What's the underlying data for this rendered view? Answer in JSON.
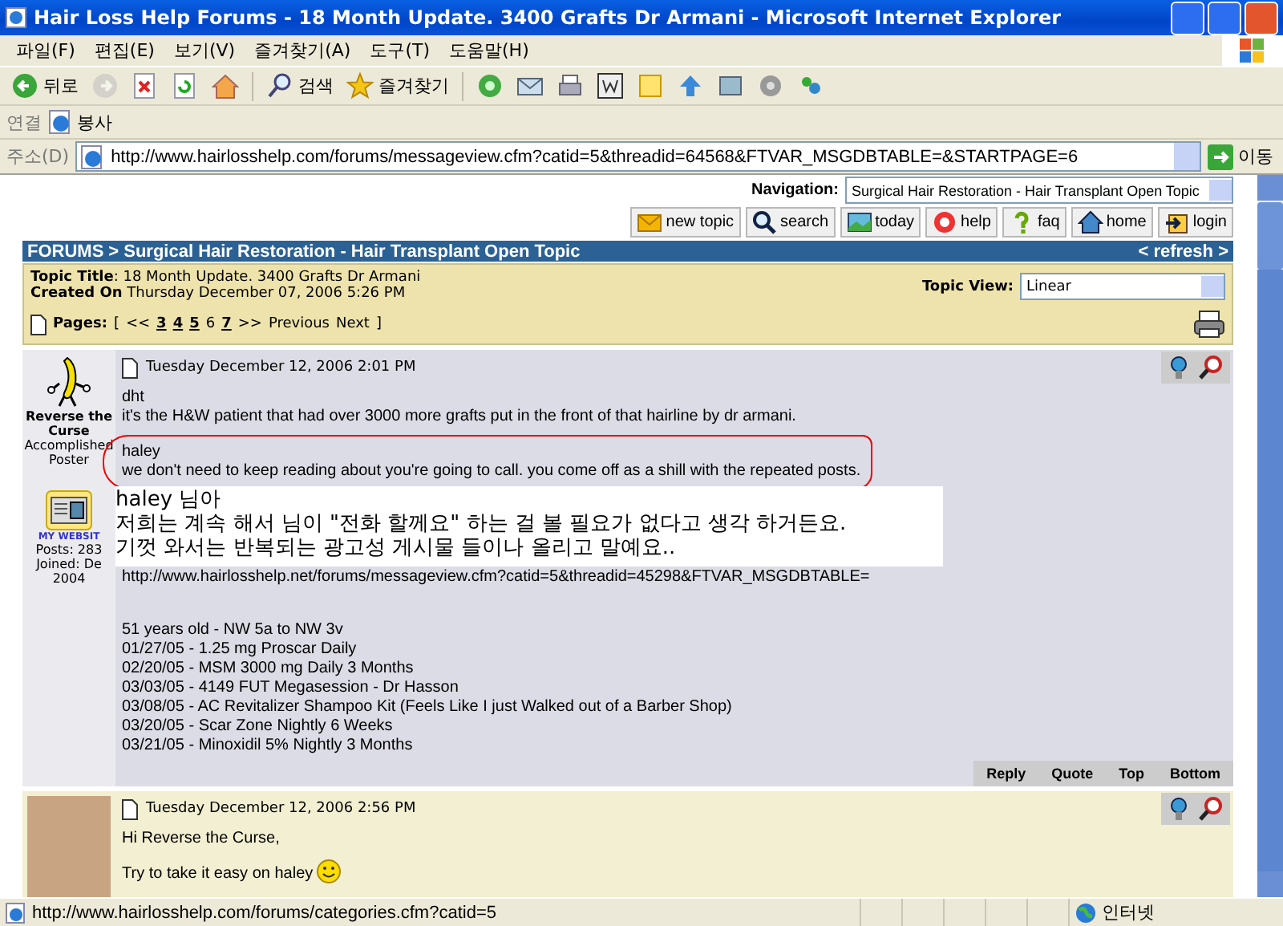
{
  "window": {
    "title": "Hair Loss Help Forums - 18 Month Update. 3400 Grafts Dr Armani - Microsoft Internet Explorer"
  },
  "menu": [
    "파일(F)",
    "편집(E)",
    "보기(V)",
    "즐겨찾기(A)",
    "도구(T)",
    "도움말(H)"
  ],
  "toolbar": [
    {
      "kind": "back",
      "label": "뒤로",
      "disabled": false
    },
    {
      "kind": "forward",
      "disabled": true
    },
    {
      "kind": "stop",
      "disabled": false
    },
    {
      "kind": "refresh",
      "disabled": false
    },
    {
      "kind": "home",
      "disabled": false
    },
    {
      "kind": "search",
      "label": "검색",
      "disabled": false
    },
    {
      "kind": "favorites",
      "label": "즐겨찾기",
      "disabled": false
    },
    {
      "kind": "media",
      "disabled": false
    },
    {
      "kind": "mail",
      "disabled": false
    },
    {
      "kind": "print",
      "disabled": false
    },
    {
      "kind": "edit",
      "disabled": false
    },
    {
      "kind": "note",
      "disabled": false
    },
    {
      "kind": "bluetool",
      "disabled": false
    },
    {
      "kind": "disk",
      "disabled": false
    },
    {
      "kind": "gear",
      "disabled": false
    },
    {
      "kind": "messenger",
      "disabled": false
    }
  ],
  "links_bar": {
    "label": "연결",
    "items": [
      "봉사"
    ]
  },
  "address": {
    "label": "주소(D)",
    "url": "http://www.hairlosshelp.com/forums/messageview.cfm?catid=5&threadid=64568&FTVAR_MSGDBTABLE=&STARTPAGE=6",
    "go": "이동"
  },
  "page": {
    "navigation": {
      "label": "Navigation:",
      "value": "Surgical Hair Restoration - Hair Transplant Open Topic"
    },
    "nav_buttons": [
      {
        "kind": "new",
        "label": "new topic"
      },
      {
        "kind": "search",
        "label": "search"
      },
      {
        "kind": "today",
        "label": "today"
      },
      {
        "kind": "help",
        "label": "help"
      },
      {
        "kind": "faq",
        "label": "faq"
      },
      {
        "kind": "home",
        "label": "home"
      },
      {
        "kind": "login",
        "label": "login"
      }
    ],
    "breadcrumb": {
      "root": "FORUMS",
      "separator": ">",
      "current": "Surgical Hair Restoration - Hair Transplant Open Topic",
      "refresh": "< refresh >"
    },
    "topic": {
      "title_label": "Topic Title",
      "title": ": 18 Month Update. 3400 Grafts Dr Armani",
      "created_label": "Created On",
      "created": "Thursday December 07, 2006 5:26 PM",
      "view_label": "Topic View:",
      "view": "Linear",
      "pages_label": "Pages:",
      "open": "[",
      "first": "<<",
      "last": ">>",
      "prev": "Previous",
      "next": "Next",
      "close": "]",
      "pages": [
        {
          "label": "3",
          "selected": false
        },
        {
          "label": "4",
          "selected": false
        },
        {
          "label": "5",
          "selected": false
        },
        {
          "label": "6",
          "selected": true
        },
        {
          "label": "7",
          "selected": false
        }
      ]
    },
    "posts": [
      {
        "kind": "cartoon",
        "highlighted": false,
        "author": "Reverse the Curse",
        "rank": "Accomplished Poster",
        "website": "MY WEBSIT",
        "posts": "Posts: 283",
        "joined": "Joined: De",
        "joined_year": "2004",
        "date": "Tuesday December 12, 2006 2:01 PM",
        "paragraphs": [
          {
            "lines": [
              "dht",
              "it's the H&W patient that had over 3000 more grafts put in the front of that hairline by dr armani."
            ],
            "circled": false,
            "smiley": false
          },
          {
            "lines": [
              "haley",
              "we don't need to keep reading about you're going to call.  you come off as a shill with the repeated posts."
            ],
            "circled": true,
            "smiley": false
          },
          {
            "lines": [
              "http://www.hairlosshelp.net/forums/messageview.cfm?catid=5&threadid=45298&FTVAR_MSGDBTABLE="
            ],
            "circled": false,
            "smiley": false
          },
          {
            "lines": [
              "51 years old - NW 5a to NW 3v",
              "01/27/05 - 1.25 mg Proscar Daily",
              "02/20/05 - MSM 3000 mg Daily 3 Months",
              "03/03/05 - 4149 FUT Megasession - Dr Hasson",
              "03/08/05 - AC Revitalizer Shampoo Kit (Feels Like I just Walked out of a Barber Shop)",
              "03/20/05 - Scar Zone Nightly 6 Weeks",
              "03/21/05 - Minoxidil 5% Nightly 3 Months"
            ],
            "circled": false,
            "smiley": false
          }
        ],
        "actions": [
          "Reply",
          "Quote",
          "Top",
          "Bottom"
        ]
      },
      {
        "kind": "photo",
        "highlighted": true,
        "date": "Tuesday December 12, 2006 2:56 PM",
        "paragraphs": [
          {
            "lines": [
              "Hi Reverse the Curse,"
            ],
            "circled": false,
            "smiley": false
          },
          {
            "lines": [
              "Try to take it easy on haley"
            ],
            "circled": false,
            "smiley": true
          }
        ]
      }
    ]
  },
  "note": {
    "lines": [
      "haley 님아",
      "저희는 계속 해서 님이 \"전화 할께요\" 하는 걸 볼 필요가 없다고 생각 하거든요.",
      "기껏 와서는 반복되는 광고성 게시물 들이나 올리고 말예요.."
    ]
  },
  "status_bar": {
    "url": "http://www.hairlosshelp.com/forums/categories.cfm?catid=5",
    "zone": "인터넷"
  }
}
